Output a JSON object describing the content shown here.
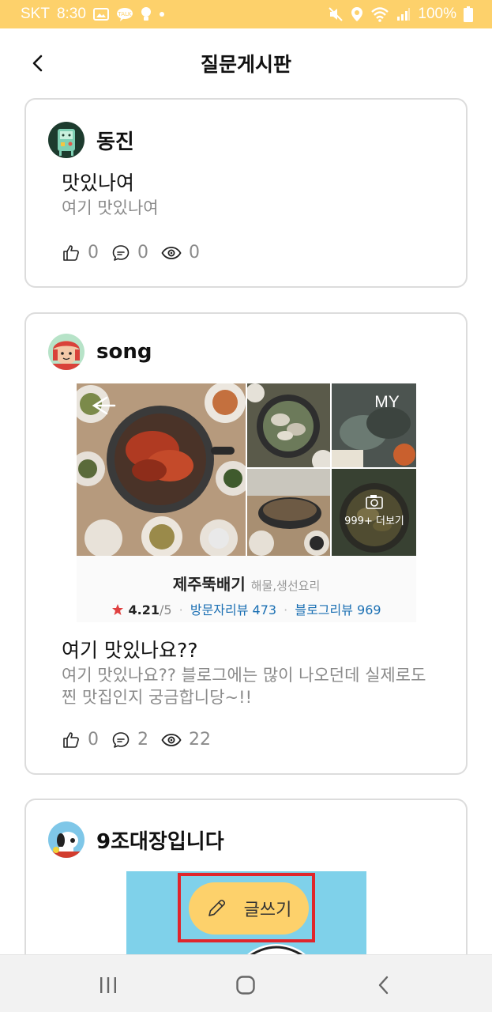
{
  "status_bar": {
    "carrier": "SKT",
    "time": "8:30",
    "battery": "100%",
    "background": "#fdd16b"
  },
  "header": {
    "title": "질문게시판"
  },
  "posts": [
    {
      "author": "동진",
      "title": "맛있나여",
      "body": "여기 맛있나여",
      "likes": "0",
      "comments": "0",
      "views": "0"
    },
    {
      "author": "song",
      "title": "여기 맛있나요??",
      "body": "여기 맛있나요?? 블로그에는 많이 나오던데 실제로도 찐 맛집인지 궁금합니당~!!",
      "likes": "0",
      "comments": "2",
      "views": "22",
      "place": {
        "name": "제주뚝배기",
        "category": "해물,생선요리",
        "rating": "4.21",
        "rating_max": "/5",
        "visitor_reviews": "방문자리뷰 473",
        "blog_reviews": "블로그리뷰 969",
        "photo_overlay_my": "MY",
        "photo_more": "999+ 더보기"
      }
    },
    {
      "author": "9조대장입니다"
    }
  ],
  "fab": {
    "label": "글쓰기",
    "highlight_color": "#e0252b"
  },
  "icons": {
    "back": "back-arrow-icon",
    "like": "thumbs-up-icon",
    "comment": "comment-bubble-icon",
    "views": "eye-icon",
    "write": "pencil-icon",
    "nav_recent": "recent-apps-icon",
    "nav_home": "home-icon",
    "nav_back": "nav-back-icon"
  }
}
